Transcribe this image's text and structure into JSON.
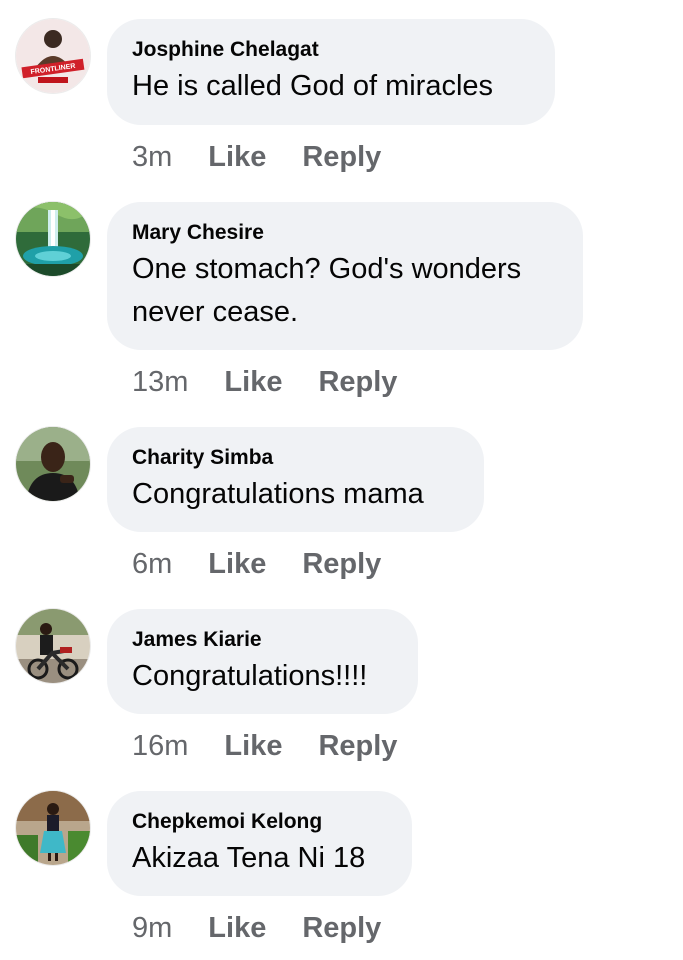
{
  "comments": [
    {
      "author": "Josphine Chelagat",
      "text": "He is called God of miracles",
      "time": "3m",
      "like_label": "Like",
      "reply_label": "Reply",
      "avatar_banner_text": "FRONTLINER"
    },
    {
      "author": "Mary Chesire",
      "text_line1": "One stomach? God's wonders",
      "text_line2": "never cease.",
      "time": "13m",
      "like_label": "Like",
      "reply_label": "Reply"
    },
    {
      "author": "Charity Simba",
      "text": "Congratulations mama",
      "time": "6m",
      "like_label": "Like",
      "reply_label": "Reply"
    },
    {
      "author": "James Kiarie",
      "text": "Congratulations!!!!",
      "time": "16m",
      "like_label": "Like",
      "reply_label": "Reply"
    },
    {
      "author": "Chepkemoi Kelong",
      "text": "Akizaa Tena Ni 18",
      "time": "9m",
      "like_label": "Like",
      "reply_label": "Reply"
    }
  ],
  "colors": {
    "bubble_bg": "#f0f2f5",
    "meta_text": "#65676b",
    "primary_text": "#050505"
  }
}
